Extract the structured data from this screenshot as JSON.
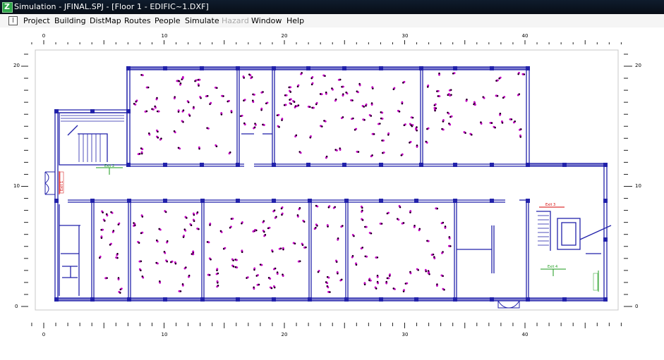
{
  "window": {
    "title": "Simulation - JFINAL.SPJ - [Floor 1 - EDIFIC~1.DXF]",
    "app_icon": "app-logo-icon"
  },
  "menu": {
    "doc_icon": "document-icon",
    "items": [
      "Project",
      "Building",
      "DistMap",
      "Routes",
      "People",
      "Simulate",
      "Hazard",
      "Window",
      "Help"
    ],
    "disabled": [
      "Hazard"
    ]
  },
  "ruler": {
    "top_labels": [
      "0",
      "10",
      "20",
      "30",
      "40"
    ],
    "bottom_labels": [
      "0",
      "10",
      "20",
      "30",
      "40"
    ],
    "left_labels": [
      "20",
      "10",
      "0"
    ],
    "right_labels": [
      "20",
      "10",
      "0"
    ]
  },
  "plan": {
    "exit_labels": [
      "Exit 1",
      "Exit 2",
      "Exit 3",
      "Exit 4"
    ],
    "wall_color": "#2222aa",
    "occupant_color": "#c000c0",
    "occupant_head_color": "#000000",
    "exit_red": "#d40000",
    "exit_green": "#1a9a1a"
  }
}
